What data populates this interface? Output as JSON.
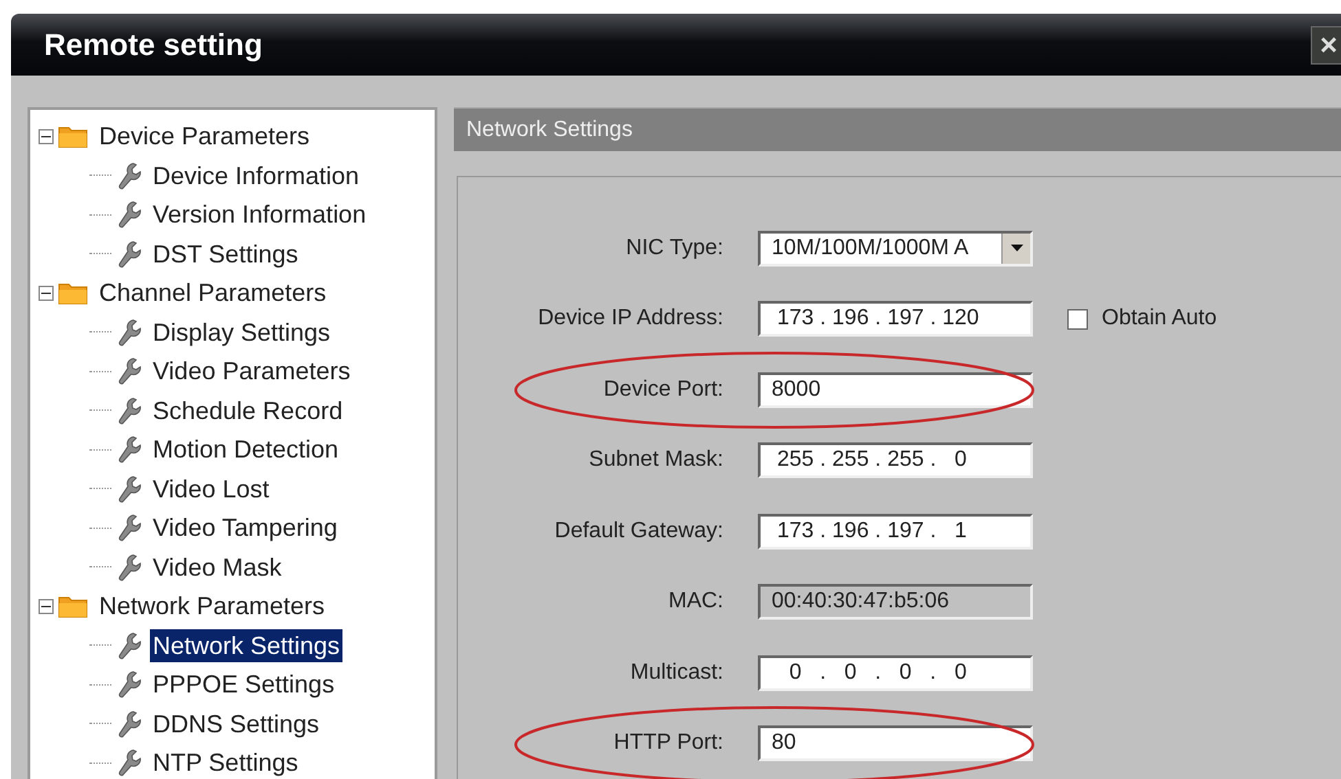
{
  "window": {
    "title": "Remote setting",
    "close": "×"
  },
  "tree": [
    {
      "label": "Device Parameters",
      "expanded": true,
      "selected": false,
      "children": [
        {
          "label": "Device Information",
          "selected": false
        },
        {
          "label": "Version Information",
          "selected": false
        },
        {
          "label": "DST Settings",
          "selected": false
        }
      ]
    },
    {
      "label": "Channel Parameters",
      "expanded": true,
      "selected": false,
      "children": [
        {
          "label": "Display Settings",
          "selected": false
        },
        {
          "label": "Video Parameters",
          "selected": false
        },
        {
          "label": "Schedule Record",
          "selected": false
        },
        {
          "label": "Motion Detection",
          "selected": false
        },
        {
          "label": "Video Lost",
          "selected": false
        },
        {
          "label": "Video Tampering",
          "selected": false
        },
        {
          "label": "Video Mask",
          "selected": false
        }
      ]
    },
    {
      "label": "Network Parameters",
      "expanded": true,
      "selected": false,
      "children": [
        {
          "label": "Network Settings",
          "selected": true
        },
        {
          "label": "PPPOE Settings",
          "selected": false
        },
        {
          "label": "DDNS Settings",
          "selected": false
        },
        {
          "label": "NTP Settings",
          "selected": false
        }
      ]
    }
  ],
  "panel": {
    "title": "Network Settings",
    "fields": [
      {
        "kind": "select",
        "label": "NIC Type:",
        "value": "10M/100M/1000M A",
        "highlighted": false
      },
      {
        "kind": "ip",
        "label": "Device IP Address:",
        "value": "173 . 196 . 197 . 120",
        "highlighted": false,
        "checkbox": {
          "label": "Obtain Auto",
          "checked": false
        }
      },
      {
        "kind": "text",
        "label": "Device Port:",
        "value": "8000",
        "highlighted": true
      },
      {
        "kind": "ip",
        "label": "Subnet Mask:",
        "value": "255 . 255 . 255 .   0",
        "highlighted": false
      },
      {
        "kind": "ip",
        "label": "Default Gateway:",
        "value": "173 . 196 . 197 .   1",
        "highlighted": false
      },
      {
        "kind": "readonly",
        "label": "MAC:",
        "value": "00:40:30:47:b5:06",
        "highlighted": false
      },
      {
        "kind": "ip",
        "label": "Multicast:",
        "value": "  0   .   0   .   0   .   0",
        "highlighted": false
      },
      {
        "kind": "text",
        "label": "HTTP Port:",
        "value": "80",
        "highlighted": true
      }
    ]
  }
}
